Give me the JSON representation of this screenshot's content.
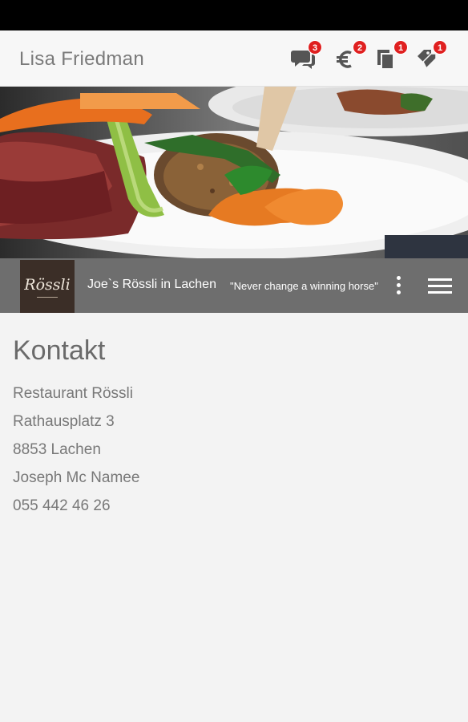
{
  "header": {
    "user_name": "Lisa Friedman",
    "icons": [
      {
        "name": "chat-icon",
        "badge": "3"
      },
      {
        "name": "euro-icon",
        "badge": "2"
      },
      {
        "name": "documents-icon",
        "badge": "1"
      },
      {
        "name": "tags-icon",
        "badge": "1"
      }
    ]
  },
  "restaurant": {
    "logo_text": "Rössli",
    "name": "Joe`s Rössli in Lachen",
    "slogan": "\"Never change a winning horse\""
  },
  "contact": {
    "title": "Kontakt",
    "lines": [
      "Restaurant Rössli",
      "Rathausplatz 3",
      "8853 Lachen",
      "Joseph Mc Namee",
      "055 442 46 26"
    ]
  }
}
